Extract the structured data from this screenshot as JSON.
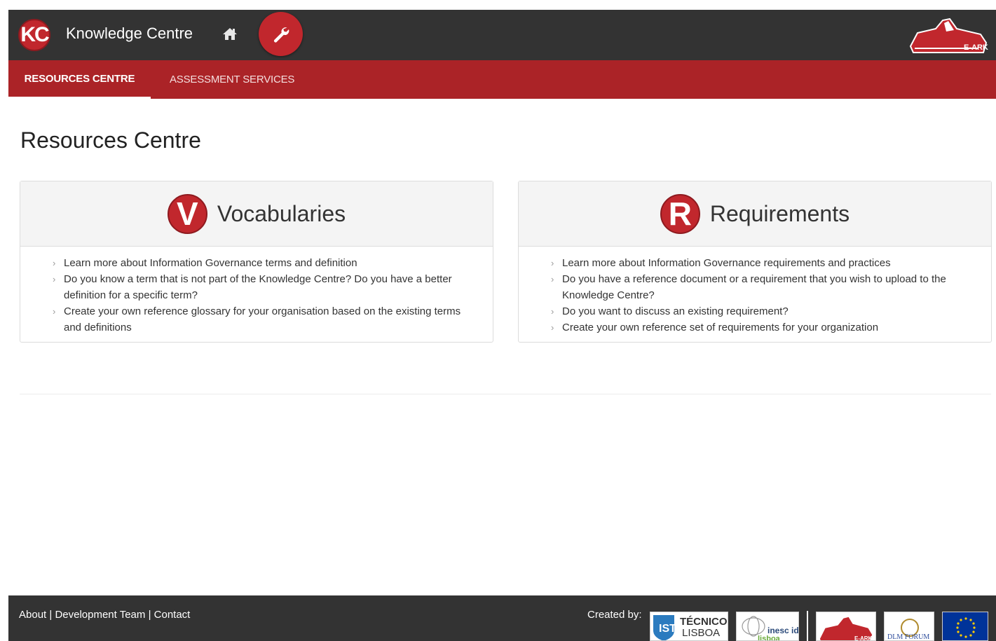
{
  "header": {
    "logo_text": "KC",
    "app_title": "Knowledge Centre",
    "eark_logo_text": "E-ARK"
  },
  "tabs": [
    {
      "label": "RESOURCES CENTRE",
      "active": true
    },
    {
      "label": "ASSESSMENT SERVICES",
      "active": false
    }
  ],
  "page": {
    "title": "Resources Centre"
  },
  "cards": [
    {
      "badge": "V",
      "title": "Vocabularies",
      "items": [
        "Learn more about Information Governance terms and definition",
        "Do you know a term that is not part of the Knowledge Centre? Do you have a better definition for a specific term?",
        "Create your own reference glossary for your organisation based on the existing terms and definitions"
      ]
    },
    {
      "badge": "R",
      "title": "Requirements",
      "items": [
        "Learn more about Information Governance requirements and practices",
        "Do you have a reference document or a requirement that you wish to upload to the Knowledge Centre?",
        "Do you want to discuss an existing requirement?",
        "Create your own reference set of requirements for your organization"
      ]
    }
  ],
  "footer": {
    "about": "About",
    "team": "Development Team",
    "contact": "Contact",
    "separator": " | ",
    "created_by": "Created by:",
    "ist_line1": "TÉCNICO",
    "ist_line2": "LISBOA",
    "inesc_line1": "inesc id",
    "inesc_line2": "lisboa",
    "eark": "E-ARK",
    "dlm": "DLM FORUM"
  },
  "colors": {
    "brand_red": "#c1272d",
    "tab_bar": "#ab2327",
    "dark_bar": "#333333"
  },
  "icons": [
    "home-icon",
    "wrench-icon",
    "chevron-right-icon"
  ]
}
